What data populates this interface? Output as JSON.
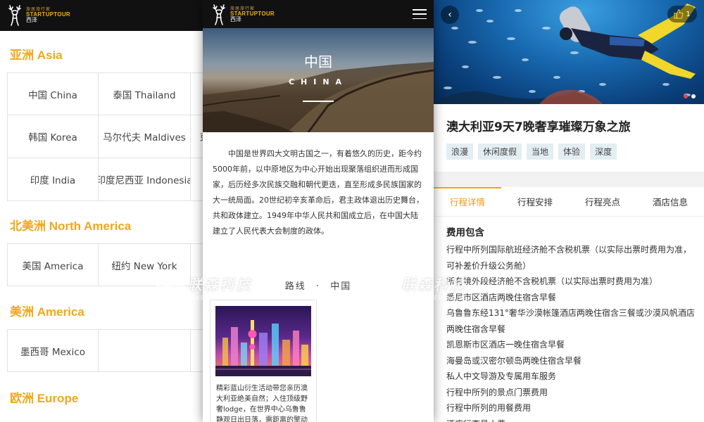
{
  "brand": {
    "line1": "旅居旅行家",
    "name": "STARTUPTOUR",
    "cn": "西泽"
  },
  "regions": {
    "asia": {
      "title": "亚洲 Asia",
      "cells": [
        "中国 China",
        "泰国 Thailand",
        "",
        "韩国 Korea",
        "马尔代夫 Maldives",
        "柬",
        "印度 India",
        "印度尼西亚 Indonesia",
        ""
      ]
    },
    "north_america": {
      "title": "北美洲 North America",
      "cells": [
        "美国 America",
        "纽约 New York",
        ""
      ]
    },
    "america": {
      "title": "美洲 America",
      "cells": [
        "墨西哥 Mexico",
        "",
        ""
      ]
    },
    "europe": {
      "title": "欧洲 Europe"
    }
  },
  "china_page": {
    "banner_cn": "中国",
    "banner_en": "CHINA",
    "intro": "中国是世界四大文明古国之一，有着悠久的历史，距今约5000年前，以中原地区为中心开始出现聚落组织进而形成国家，后历经多次民族交融和朝代更迭，直至形成多民族国家的大一统局面。20世纪初辛亥革命后，君主政体退出历史舞台，共和政体建立。1949年中华人民共和国成立后，在中国大陆建立了人民代表大会制度的政体。",
    "route_label": "路线",
    "route_dot": "·",
    "route_region": "中国",
    "card_text": "精彩蓝山衍生活动带您亲历澳大利亚绝美自然；入住顶级野奢lodge，在世界中心乌鲁鲁静观日出日落，需距离的擎动"
  },
  "trip": {
    "like_count": "1",
    "title": "澳大利亚9天7晚奢享璀璨万象之旅",
    "tags": [
      "浪漫",
      "休闲度假",
      "当地",
      "体验",
      "深度"
    ],
    "tabs": [
      "行程详情",
      "行程安排",
      "行程亮点",
      "酒店信息"
    ],
    "fee_heading": "费用包含",
    "fee_items": [
      "行程中所列国际航班经济舱不含税机票（以实际出票时费用为准，可补差价升级公务舱）",
      "所有境外段经济舱不含税机票（以实际出票时费用为准）",
      "悉尼市区酒店两晚住宿含早餐",
      "乌鲁鲁东经131°奢华沙漠帐篷酒店两晚住宿含三餐或沙漠风帆酒店两晚住宿含早餐",
      "凯恩斯市区酒店一晚住宿含早餐",
      "海曼岛或汉密尔顿岛两晚住宿含早餐",
      "私人中文导游及专属用车服务",
      "行程中所列的景点门票费用",
      "行程中所列的用餐费用",
      "酒店行李员小费"
    ]
  },
  "watermark": {
    "cn": "联森科技",
    "en": "LANSOO TECHNOLOGY"
  }
}
